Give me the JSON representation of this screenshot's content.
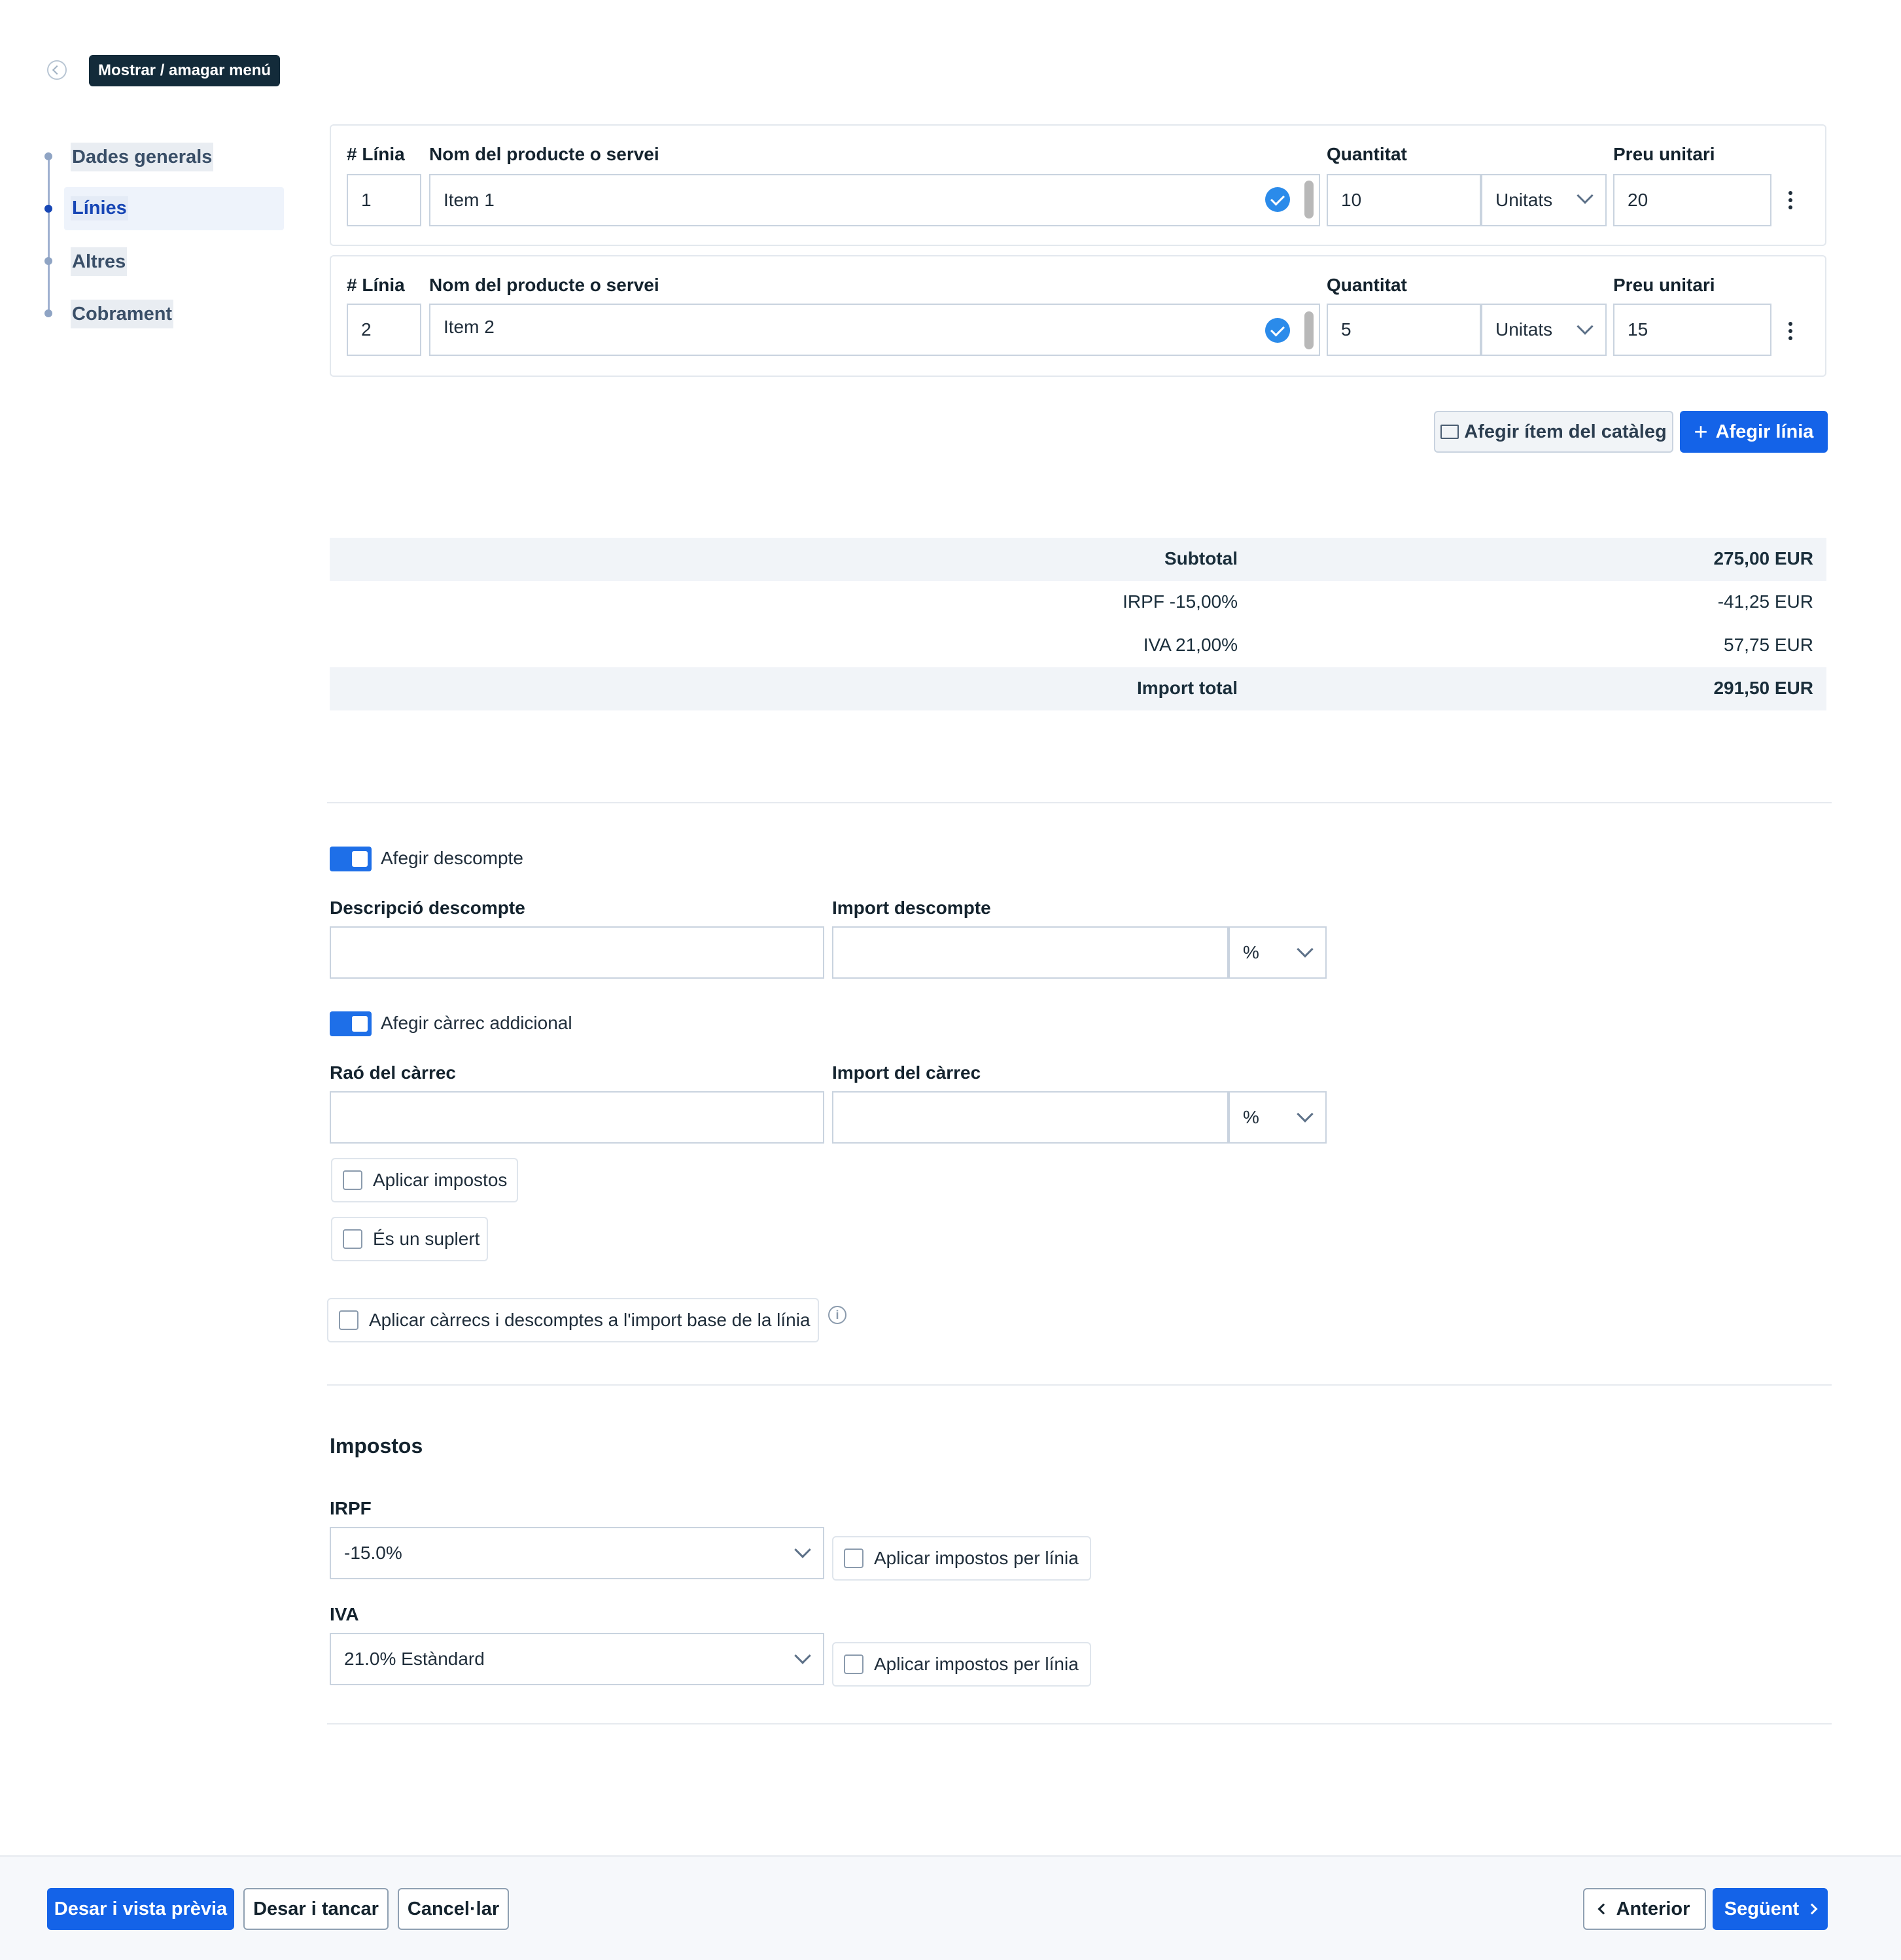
{
  "menu": {
    "toggle_label": "Mostrar / amagar menú"
  },
  "steps": [
    {
      "label": "Dades generals"
    },
    {
      "label": "Línies"
    },
    {
      "label": "Altres"
    },
    {
      "label": "Cobrament"
    }
  ],
  "lines_header": {
    "line_no": "# Línia",
    "product": "Nom del producte o servei",
    "quantity": "Quantitat",
    "unit_price": "Preu unitari"
  },
  "lines": [
    {
      "line_no": "1",
      "product": "Item 1",
      "quantity": "10",
      "unit": "Unitats",
      "unit_price": "20"
    },
    {
      "line_no": "2",
      "product": "Item 2",
      "quantity": "5",
      "unit": "Unitats",
      "unit_price": "15"
    }
  ],
  "actions": {
    "add_catalog": "Afegir ítem del catàleg",
    "add_line": "Afegir línia"
  },
  "summary": [
    {
      "label": "Subtotal",
      "value": "275,00 EUR"
    },
    {
      "label": "IRPF -15,00%",
      "value": "-41,25 EUR"
    },
    {
      "label": "IVA 21,00%",
      "value": "57,75 EUR"
    },
    {
      "label": "Import total",
      "value": "291,50 EUR"
    }
  ],
  "discount": {
    "toggle_label": "Afegir descompte",
    "desc_label": "Descripció descompte",
    "amount_label": "Import descompte",
    "desc_value": "",
    "amount_value": "",
    "type": "%"
  },
  "charge": {
    "toggle_label": "Afegir càrrec addicional",
    "reason_label": "Raó del càrrec",
    "amount_label": "Import del càrrec",
    "reason_value": "",
    "amount_value": "",
    "type": "%",
    "apply_taxes": "Aplicar impostos",
    "is_supplement": "És un suplert"
  },
  "apply_base": "Aplicar càrrecs i descomptes a l'import base de la línia",
  "taxes": {
    "title": "Impostos",
    "irpf_label": "IRPF",
    "irpf_value": "-15.0%",
    "iva_label": "IVA",
    "iva_value": "21.0% Estàndard",
    "per_line": "Aplicar impostos per línia"
  },
  "footer": {
    "save_preview": "Desar i vista prèvia",
    "save_close": "Desar i tancar",
    "cancel": "Cancel·lar",
    "previous": "Anterior",
    "next": "Següent"
  },
  "colors": {
    "accent": "#1463e8",
    "nav_active_bg": "#eef3fb",
    "tooltip_bg": "#132b3a"
  }
}
